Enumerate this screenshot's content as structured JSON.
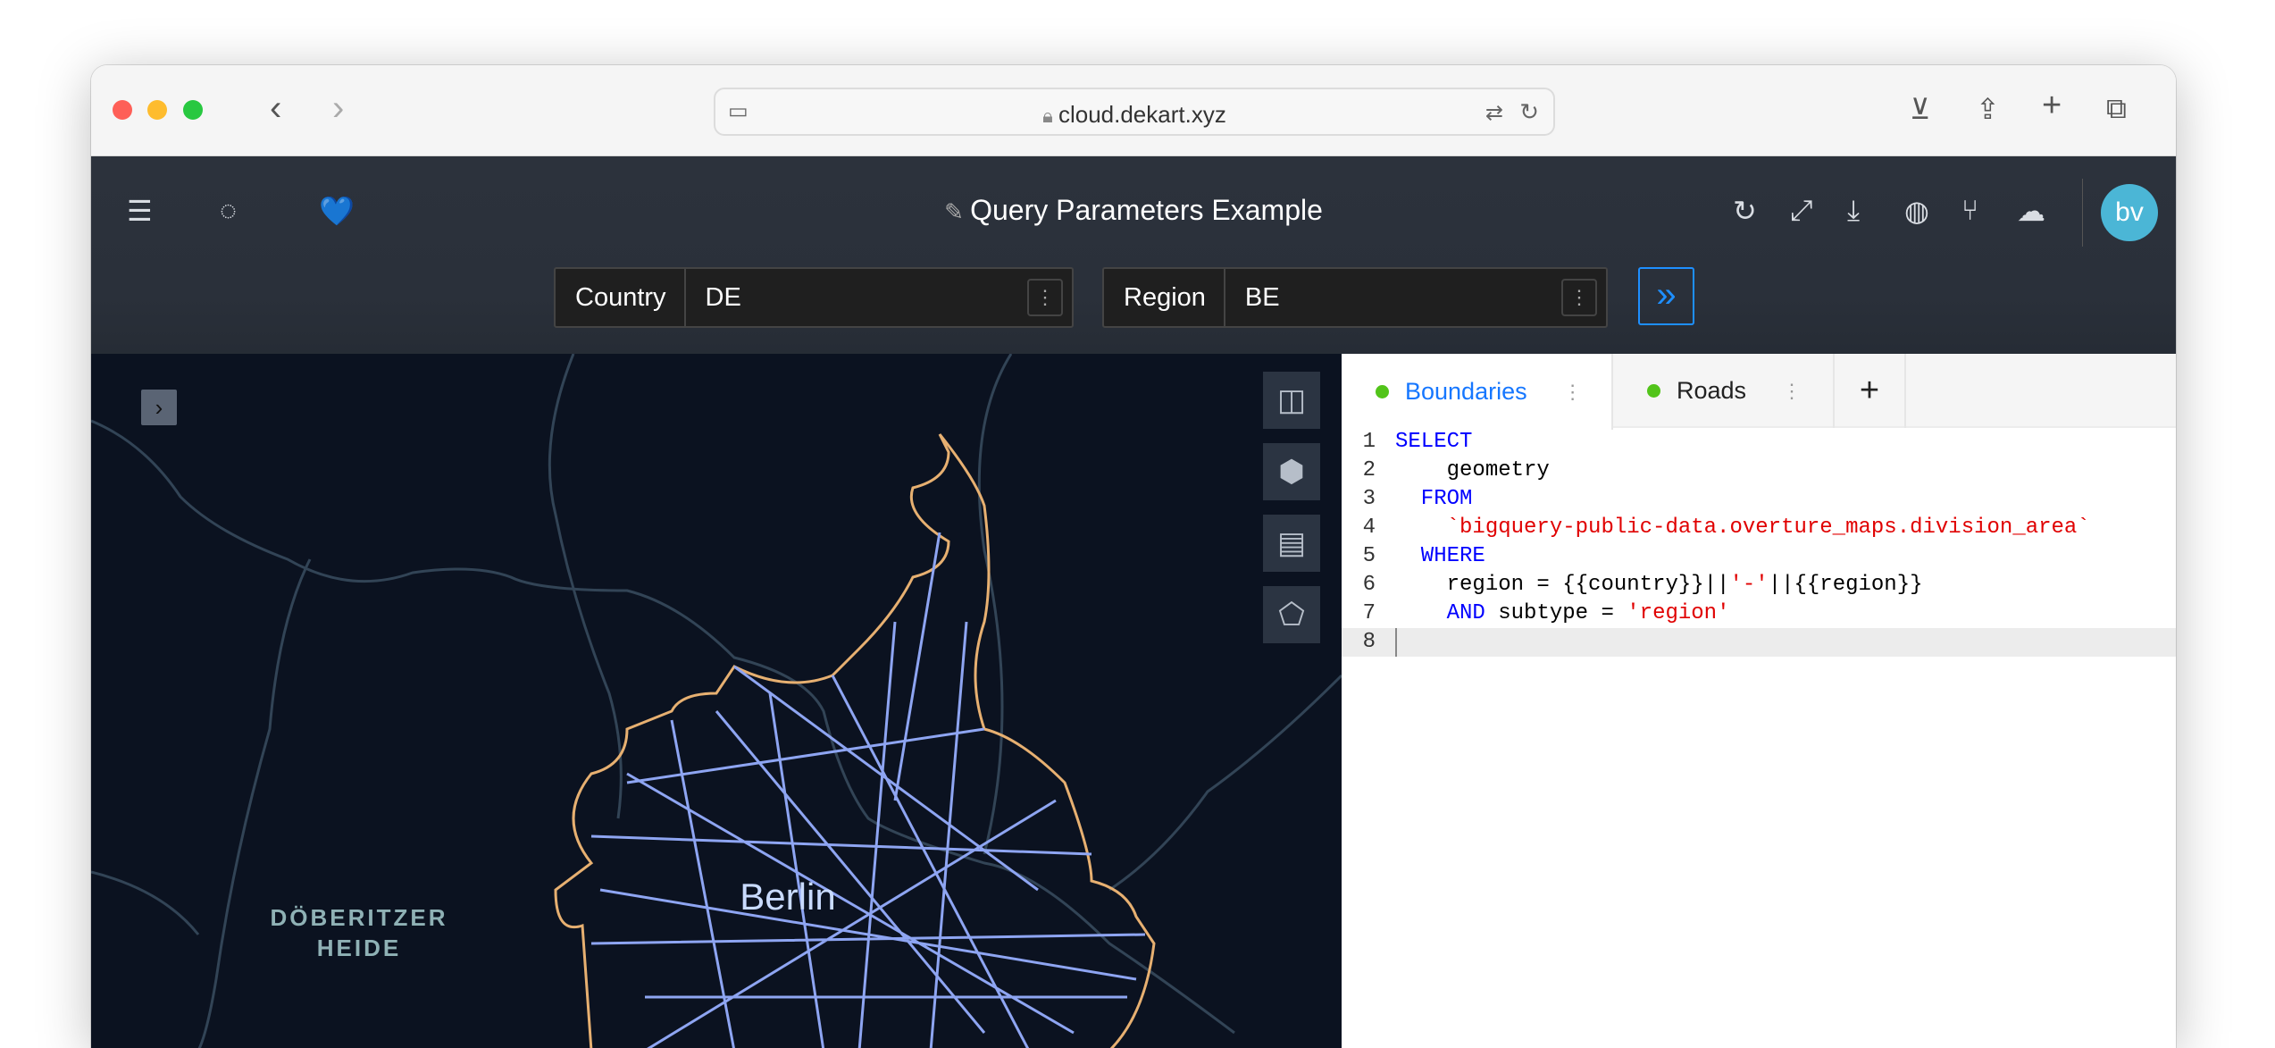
{
  "browser": {
    "url": "cloud.dekart.xyz"
  },
  "app": {
    "title": "Query Parameters Example",
    "avatar": "bv",
    "heart": "💙"
  },
  "params": [
    {
      "label": "Country",
      "value": "DE"
    },
    {
      "label": "Region",
      "value": "BE"
    }
  ],
  "map": {
    "place_labels": [
      "DÖBERITZER",
      "HEIDE",
      "Berlin"
    ]
  },
  "tabs": [
    {
      "label": "Boundaries",
      "status_color": "#52c41a",
      "active": true
    },
    {
      "label": "Roads",
      "status_color": "#52c41a",
      "active": false
    }
  ],
  "add_tab": "+",
  "code": {
    "line_numbers": [
      "1",
      "2",
      "3",
      "4",
      "5",
      "6",
      "7",
      "8"
    ],
    "l1": "SELECT",
    "l2": "    geometry",
    "l3": "  FROM",
    "l4": "    `bigquery-public-data.overture_maps.division_area`",
    "l5": "  WHERE",
    "l6a": "    region = {{country}}||",
    "l6b": "'-'",
    "l6c": "||{{region}}",
    "l7a": "    AND",
    "l7b": " subtype = ",
    "l7c": "'region'"
  }
}
